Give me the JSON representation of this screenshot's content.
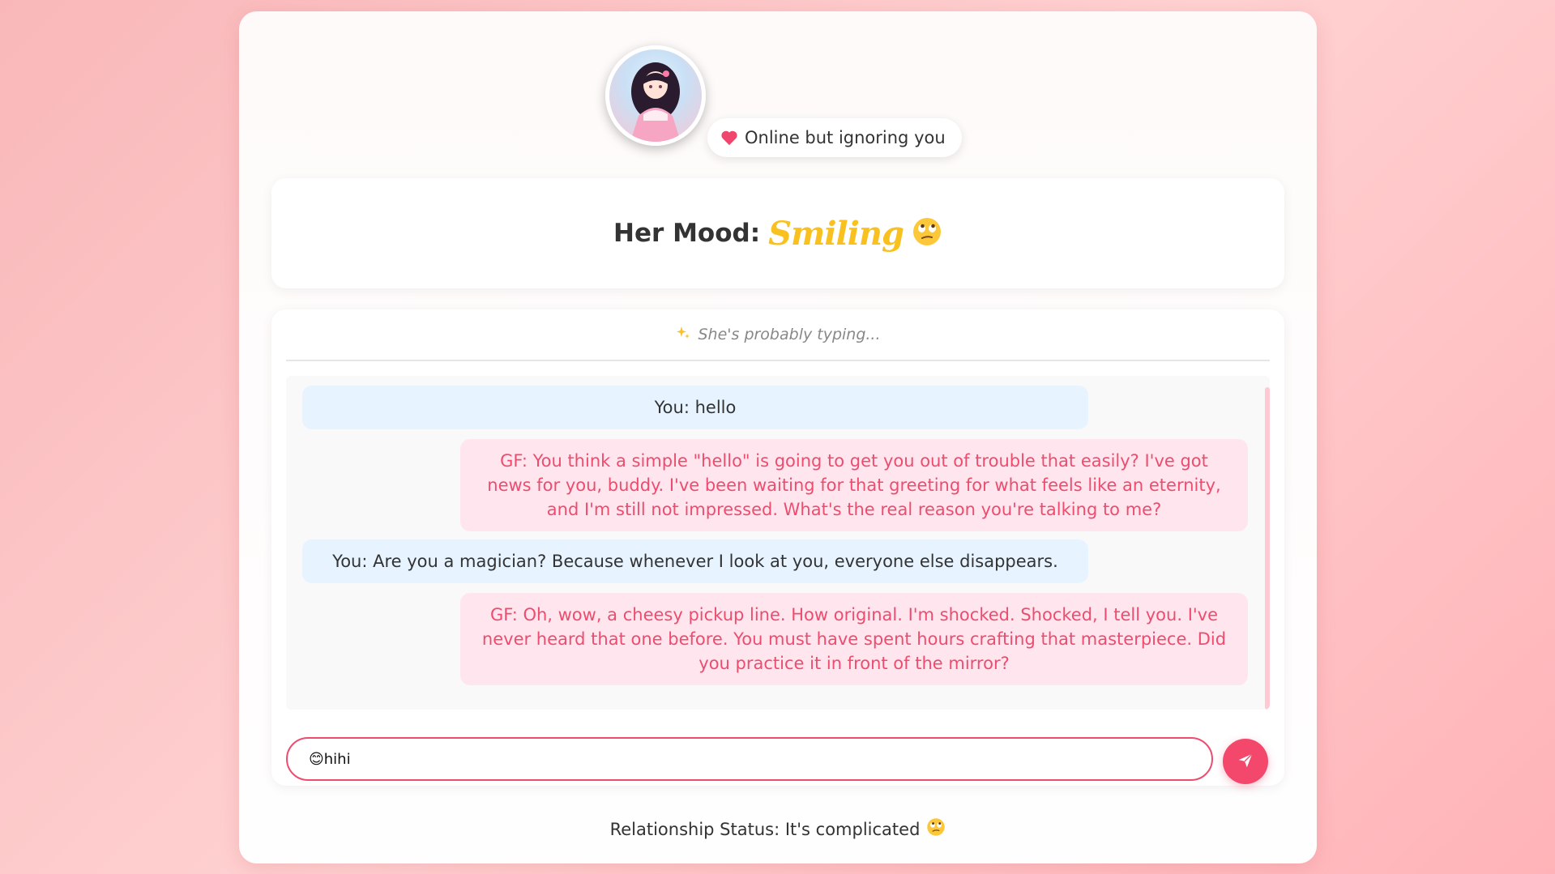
{
  "header": {
    "avatar_icon": "anime-girl-avatar",
    "status_icon": "heart-icon",
    "status_text": "Online but ignoring you"
  },
  "mood": {
    "label": "Her Mood:",
    "value": "Smiling",
    "emoji_icon": "eye-roll-face-icon"
  },
  "chat": {
    "typing_icon": "sparkles-icon",
    "typing_text": "She's probably typing...",
    "messages": [
      {
        "sender": "you",
        "text": "You: hello"
      },
      {
        "sender": "gf",
        "text": "GF: You think a simple \"hello\" is going to get you out of trouble that easily? I've got news for you, buddy. I've been waiting for that greeting for what feels like an eternity, and I'm still not impressed. What's the real reason you're talking to me?"
      },
      {
        "sender": "you",
        "text": "You: Are you a magician? Because whenever I look at you, everyone else disappears."
      },
      {
        "sender": "gf",
        "text": "GF: Oh, wow, a cheesy pickup line. How original. I'm shocked. Shocked, I tell you. I've never heard that one before. You must have spent hours crafting that masterpiece. Did you practice it in front of the mirror?"
      }
    ],
    "input_value": "😊hihi",
    "send_icon": "paper-plane-icon"
  },
  "footer": {
    "text": "Relationship Status: It's complicated",
    "emoji_icon": "eye-roll-face-icon"
  },
  "colors": {
    "accent": "#f3476c",
    "gf_text": "#ee4c6f",
    "gf_bubble": "#ffe6ee",
    "you_bubble": "#e7f4ff",
    "mood_value": "#f9c120"
  }
}
